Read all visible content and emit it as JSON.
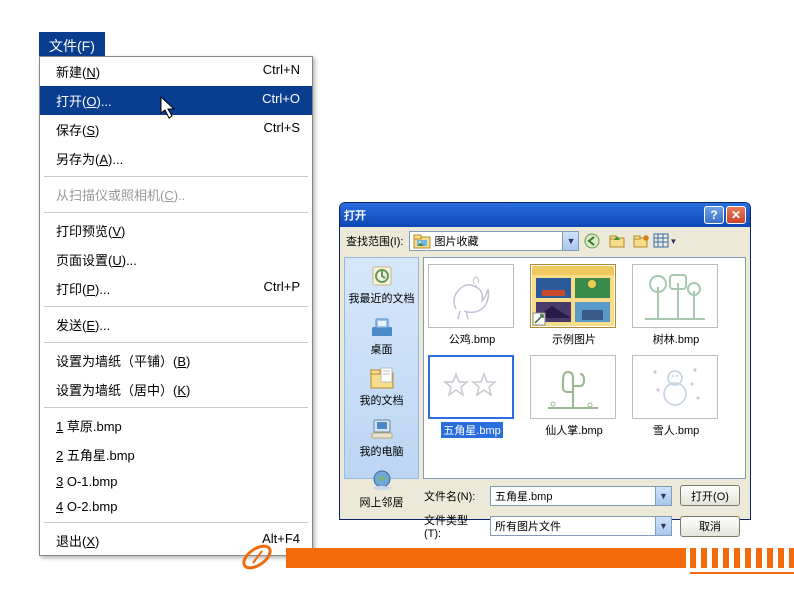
{
  "menu": {
    "title": "文件(F)",
    "items": [
      {
        "label": "新建(N)",
        "shortcut": "Ctrl+N"
      },
      {
        "label": "打开(O)...",
        "shortcut": "Ctrl+O",
        "hl": true
      },
      {
        "label": "保存(S)",
        "shortcut": "Ctrl+S"
      },
      {
        "label": "另存为(A)..."
      },
      {
        "sep": true
      },
      {
        "label": "从扫描仪或照相机(C)..",
        "disabled": true
      },
      {
        "sep": true
      },
      {
        "label": "打印预览(V)"
      },
      {
        "label": "页面设置(U)..."
      },
      {
        "label": "打印(P)...",
        "shortcut": "Ctrl+P"
      },
      {
        "sep": true
      },
      {
        "label": "发送(E)..."
      },
      {
        "sep": true
      },
      {
        "label": "设置为墙纸（平铺）(B)"
      },
      {
        "label": "设置为墙纸（居中）(K)"
      },
      {
        "sep": true
      },
      {
        "label": "1 草原.bmp"
      },
      {
        "label": "2 五角星.bmp"
      },
      {
        "label": "3 O-1.bmp"
      },
      {
        "label": "4 O-2.bmp"
      },
      {
        "sep": true
      },
      {
        "label": "退出(X)",
        "shortcut": "Alt+F4"
      }
    ]
  },
  "dialog": {
    "title": "打开",
    "look_in_label": "查找范围(I):",
    "look_in_value": "图片收藏",
    "places": [
      {
        "name": "我最近的文档"
      },
      {
        "name": "桌面"
      },
      {
        "name": "我的文档"
      },
      {
        "name": "我的电脑"
      },
      {
        "name": "网上邻居"
      }
    ],
    "files": [
      {
        "name": "公鸡.bmp",
        "kind": "rooster"
      },
      {
        "name": "示例图片",
        "kind": "samples"
      },
      {
        "name": "树林.bmp",
        "kind": "trees"
      },
      {
        "name": "五角星.bmp",
        "kind": "stars",
        "selected": true
      },
      {
        "name": "仙人掌.bmp",
        "kind": "cactus"
      },
      {
        "name": "雪人.bmp",
        "kind": "snowman"
      }
    ],
    "filename_label": "文件名(N):",
    "filename_value": "五角星.bmp",
    "filetype_label": "文件类型(T):",
    "filetype_value": "所有图片文件",
    "open_btn": "打开(O)",
    "cancel_btn": "取消"
  }
}
